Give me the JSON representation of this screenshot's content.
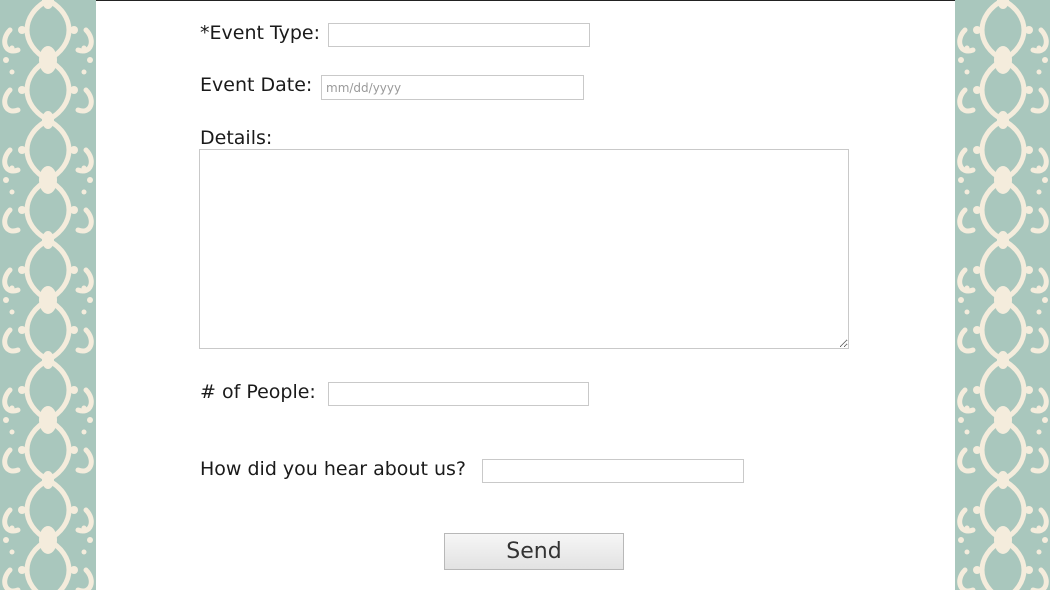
{
  "form": {
    "event_type_label": "*Event Type:",
    "event_type_value": "",
    "event_date_label": "Event Date:",
    "event_date_placeholder": "mm/dd/yyyy",
    "details_label": "Details:",
    "details_value": "",
    "people_label": "# of People:",
    "people_value": "",
    "referral_label": "How did you hear about us?",
    "referral_value": "",
    "send_label": "Send"
  },
  "colors": {
    "pattern_background": "#a9c7bd",
    "pattern_foreground": "#f4ecdc",
    "panel": "#ffffff"
  }
}
